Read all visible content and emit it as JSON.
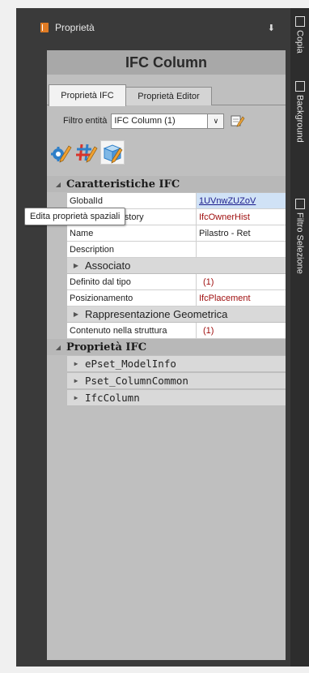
{
  "panel": {
    "title": "Proprietà",
    "pin_glyph": "⬇",
    "header": "IFC Column"
  },
  "right_tabs": [
    {
      "label": "Copia",
      "icon": "copy-icon"
    },
    {
      "label": "Background",
      "icon": "background-icon"
    },
    {
      "label": "Filtro Selezione",
      "icon": "filter-icon"
    }
  ],
  "tabs": [
    {
      "label": "Proprietà IFC",
      "active": true
    },
    {
      "label": "Proprietà Editor",
      "active": false
    }
  ],
  "filter": {
    "label": "Filtro entità",
    "value": "IFC Column (1)",
    "dropdown_glyph": "∨"
  },
  "toolbar": {
    "buttons": [
      {
        "icon": "edit-properties-icon"
      },
      {
        "icon": "edit-hash-icon"
      },
      {
        "icon": "edit-spatial-icon",
        "selected": true
      }
    ]
  },
  "tooltip": "Edita proprietà spaziali",
  "groups": {
    "caratteristiche": "Caratteristiche IFC",
    "proprieta": "Proprietà IFC"
  },
  "properties": [
    {
      "name": "GlobalId",
      "value": "1UVnwZUZoV"
    },
    {
      "name": "OwnerHistory",
      "value": "IfcOwnerHist"
    },
    {
      "name": "Name",
      "value": "Pilastro - Ret"
    },
    {
      "name": "Description",
      "value": ""
    }
  ],
  "associato": "Associato",
  "properties2": [
    {
      "name": "Definito dal tipo",
      "value": "(1)"
    },
    {
      "name": "Posizionamento",
      "value": "IfcPlacement"
    }
  ],
  "rappresentazione": "Rappresentazione Geometrica",
  "properties3": [
    {
      "name": "Contenuto nella struttura",
      "value": "(1)"
    }
  ],
  "psets": [
    "ePset_ModelInfo",
    "Pset_ColumnCommon",
    "IfcColumn"
  ],
  "colors": {
    "frame": "#3a3a3a",
    "panel": "#bfbfbf",
    "header": "#a8a8a8",
    "value_red": "#a01010",
    "accent_orange": "#e07b24"
  }
}
